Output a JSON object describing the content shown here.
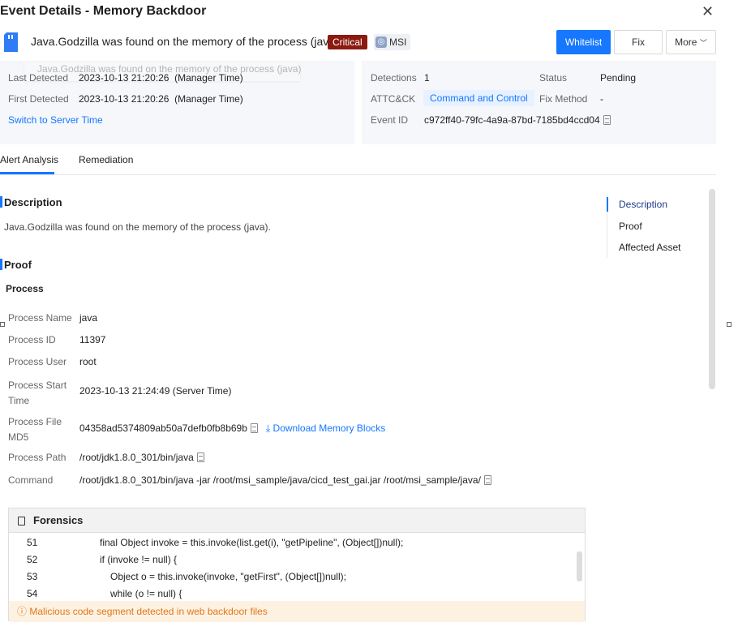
{
  "title": "Event Details - Memory Backdoor",
  "header": {
    "text": "Java.Godzilla was found on the memory of the process (java)",
    "severity": "Critical",
    "source": "MSI",
    "buttons": {
      "whitelist": "Whitelist",
      "fix": "Fix",
      "more": "More"
    }
  },
  "tooltip": "Java.Godzilla was found on the memory of the process (java)",
  "left_panel": {
    "last_detected_label": "Last Detected",
    "last_detected": "2023-10-13 21:20:26  (Manager Time)",
    "first_detected_label": "First Detected",
    "first_detected": "2023-10-13 21:20:26  (Manager Time)",
    "switch_link": "Switch to Server Time"
  },
  "right_panel": {
    "detections_label": "Detections",
    "detections": "1",
    "status_label": "Status",
    "status": "Pending",
    "attck_label": "ATTC&CK",
    "attck": "Command and Control",
    "fix_method_label": "Fix Method",
    "fix_method": "-",
    "event_id_label": "Event ID",
    "event_id": "c972ff40-79fc-4a9a-87bd-7185bd4ccd04"
  },
  "tabs": [
    "Alert Analysis",
    "Remediation"
  ],
  "description": {
    "heading": "Description",
    "text": "Java.Godzilla was found on the memory of the process (java)."
  },
  "proof": {
    "heading": "Proof",
    "sub": "Process",
    "rows": [
      {
        "label": "Process Name",
        "value": "java"
      },
      {
        "label": "Process ID",
        "value": "11397"
      },
      {
        "label": "Process User",
        "value": "root"
      },
      {
        "label": "Process Start\nTime",
        "value": "2023-10-13 21:24:49 (Server Time)"
      },
      {
        "label": "Process File\nMD5",
        "value": "04358ad5374809ab50a7defb0fb8b69b"
      },
      {
        "label": "Process Path",
        "value": "/root/jdk1.8.0_301/bin/java"
      },
      {
        "label": "Command",
        "value": "/root/jdk1.8.0_301/bin/java -jar /root/msi_sample/java/cicd_test_gai.jar /root/msi_sample/java/"
      }
    ],
    "download": "Download Memory Blocks"
  },
  "side_nav": [
    "Description",
    "Proof",
    "Affected Asset"
  ],
  "forensics": {
    "heading": "Forensics",
    "lines": [
      {
        "n": "51",
        "code": "final Object invoke = this.invoke(list.get(i), \"getPipeline\", (Object[])null);"
      },
      {
        "n": "52",
        "code": "if (invoke != null) {"
      },
      {
        "n": "53",
        "code": "Object o = this.invoke(invoke, \"getFirst\", (Object[])null);"
      },
      {
        "n": "54",
        "code": "while (o != null) {"
      }
    ],
    "warning": "Malicious code segment detected in web backdoor files"
  },
  "colors": {
    "accent": "#1677ff",
    "critical": "#8b1a10",
    "warning": "#e0771c"
  }
}
